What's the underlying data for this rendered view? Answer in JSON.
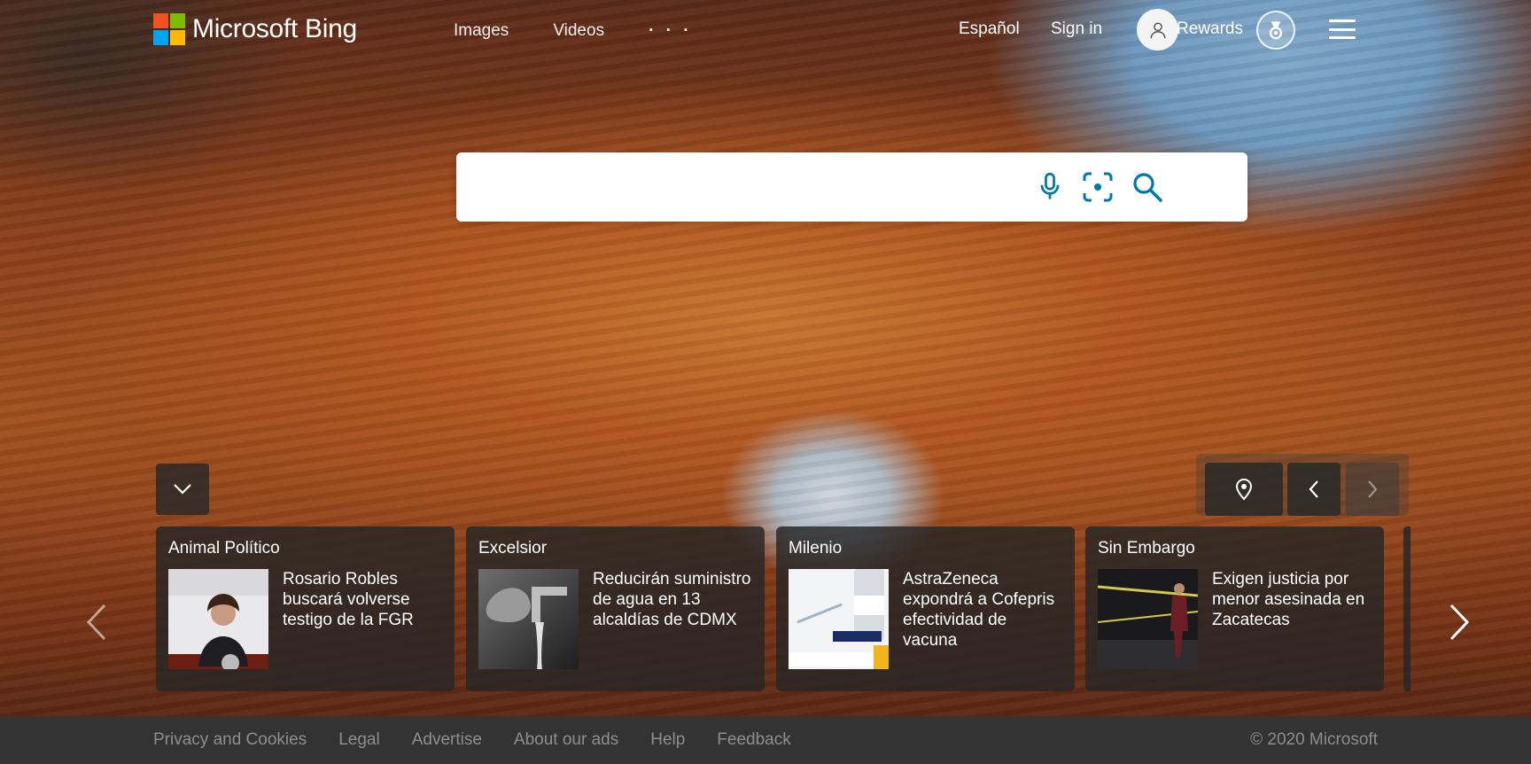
{
  "header": {
    "logo_text": "Microsoft Bing",
    "nav": [
      {
        "label": "Images"
      },
      {
        "label": "Videos"
      },
      {
        "label": "· · ·"
      }
    ],
    "language_label": "Español",
    "signin_label": "Sign in",
    "rewards_label": "Rewards"
  },
  "search": {
    "value": "",
    "placeholder": "",
    "icons": [
      "microphone-icon",
      "visual-search-icon",
      "search-icon"
    ]
  },
  "news": {
    "cards": [
      {
        "source": "Animal Político",
        "title": "Rosario Robles buscará volverse testigo de la FGR"
      },
      {
        "source": "Excelsior",
        "title": "Reducirán suministro de agua en 13 alcaldías de CDMX"
      },
      {
        "source": "Milenio",
        "title": "AstraZeneca expondrá a Cofepris efectividad de vacuna"
      },
      {
        "source": "Sin Embargo",
        "title": "Exigen justicia por menor asesinada en Zacatecas"
      }
    ]
  },
  "footer": {
    "links": [
      {
        "label": "Privacy and Cookies"
      },
      {
        "label": "Legal"
      },
      {
        "label": "Advertise"
      },
      {
        "label": "About our ads"
      },
      {
        "label": "Help"
      },
      {
        "label": "Feedback"
      }
    ],
    "copyright": "© 2020 Microsoft"
  },
  "colors": {
    "accent": "#0078a8",
    "footer_bg": "#333333",
    "footer_text": "#8e8e8e",
    "card_bg": "#262626"
  }
}
